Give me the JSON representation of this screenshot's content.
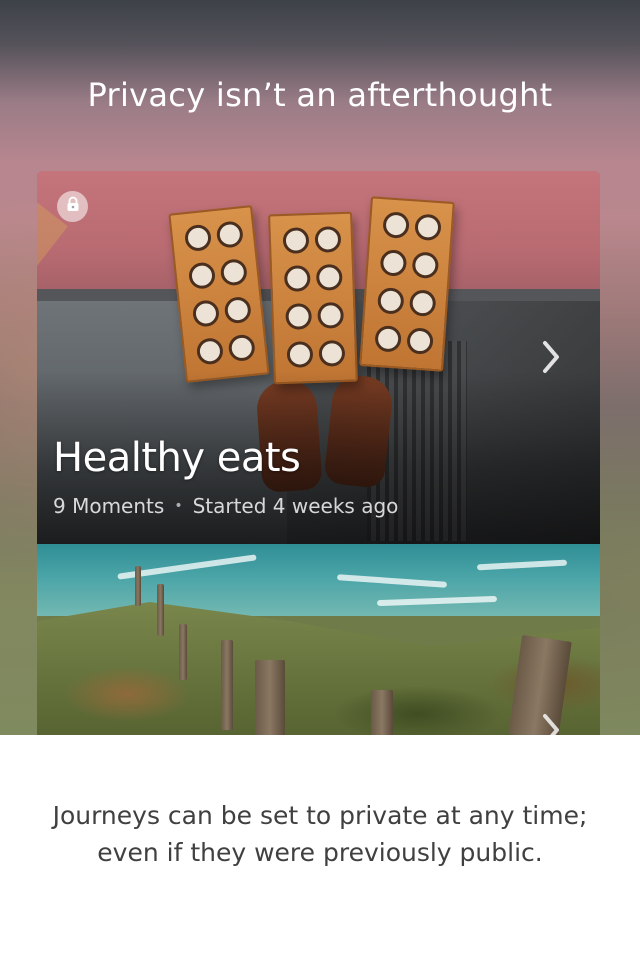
{
  "hero": {
    "title": "Privacy isn’t an afterthought"
  },
  "journeys": [
    {
      "title": "Healthy eats",
      "moments": "9 Moments",
      "separator": "•",
      "started": "Started 4 weeks ago",
      "private": true,
      "icon": "lock-icon"
    },
    {
      "title": "",
      "icon": "chevron-right-icon"
    }
  ],
  "caption": {
    "line1": "Journeys can be set to private at any time;",
    "line2": "even if they were previously public."
  },
  "colors": {
    "background": "#ffffff",
    "caption_text": "#404040",
    "overlay_text": "#ffffff"
  }
}
